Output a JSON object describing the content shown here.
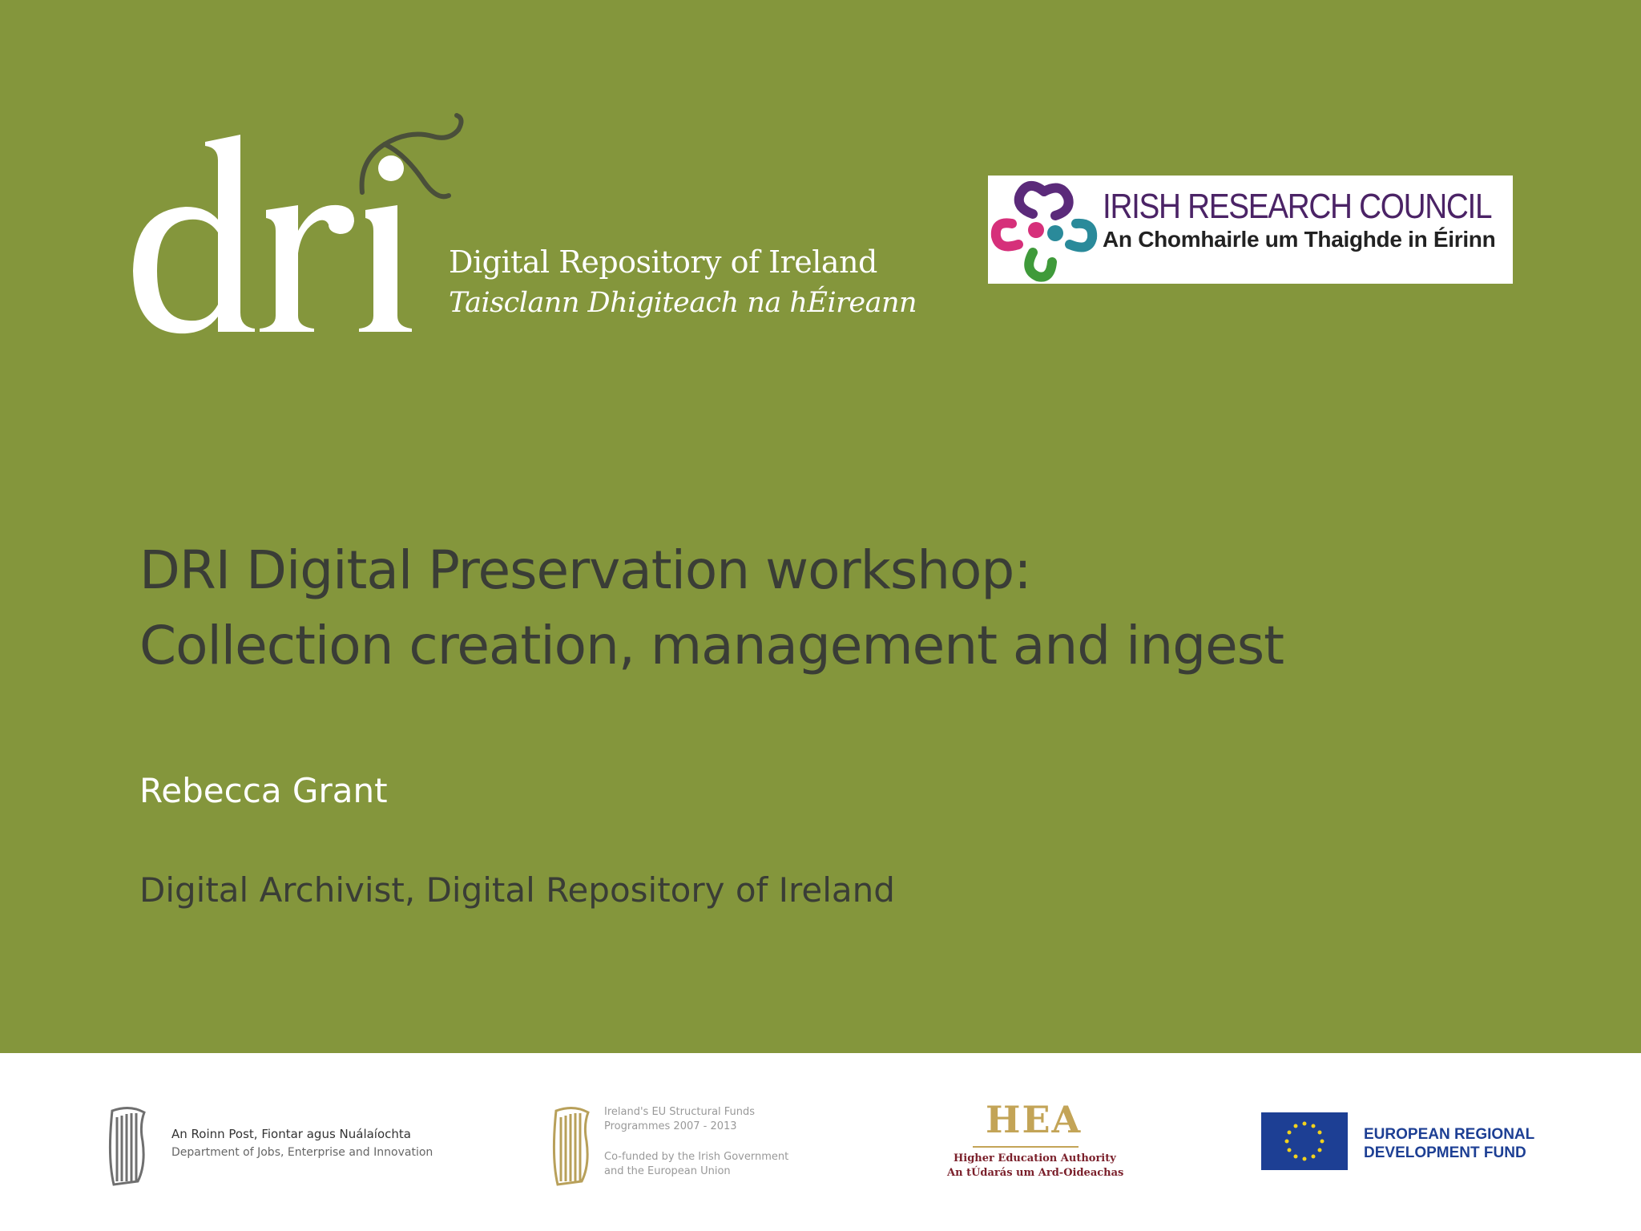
{
  "colors": {
    "background_green": "#84963c",
    "footer_white": "#ffffff",
    "title_text": "#3a3d36",
    "author_text": "#ffffff",
    "irc_purple": "#4b2366",
    "hea_gold": "#c3a457",
    "eu_blue": "#1d3f94"
  },
  "header": {
    "dri_logo": {
      "wordmark": "dri",
      "subtitle_en": "Digital Repository of Ireland",
      "subtitle_ga": "Taisclann Dhigiteach na hÉireann"
    },
    "irc_logo": {
      "title": "IRISH RESEARCH COUNCIL",
      "subtitle": "An Chomhairle um Thaighde in Éirinn"
    }
  },
  "main": {
    "title_line1": "DRI Digital Preservation workshop:",
    "title_line2": "Collection creation, management and ingest",
    "author": "Rebecca Grant",
    "role": "Digital Archivist, Digital Repository of Ireland"
  },
  "footer": {
    "dept": {
      "icon": "harp-icon",
      "line1": "An Roinn Post, Fiontar agus Nuálaíochta",
      "line2": "Department of Jobs, Enterprise and Innovation"
    },
    "structural_funds": {
      "icon": "harp-icon",
      "line1": "Ireland's EU Structural Funds",
      "line2": "Programmes 2007 - 2013",
      "line3": "Co-funded by the Irish Government",
      "line4": "and the European Union"
    },
    "hea": {
      "title": "HEA",
      "line1": "Higher Education Authority",
      "line2": "An tÚdarás um Ard-Oideachas"
    },
    "erdf": {
      "icon": "eu-flag-icon",
      "line1": "EUROPEAN REGIONAL",
      "line2": "DEVELOPMENT FUND"
    }
  }
}
